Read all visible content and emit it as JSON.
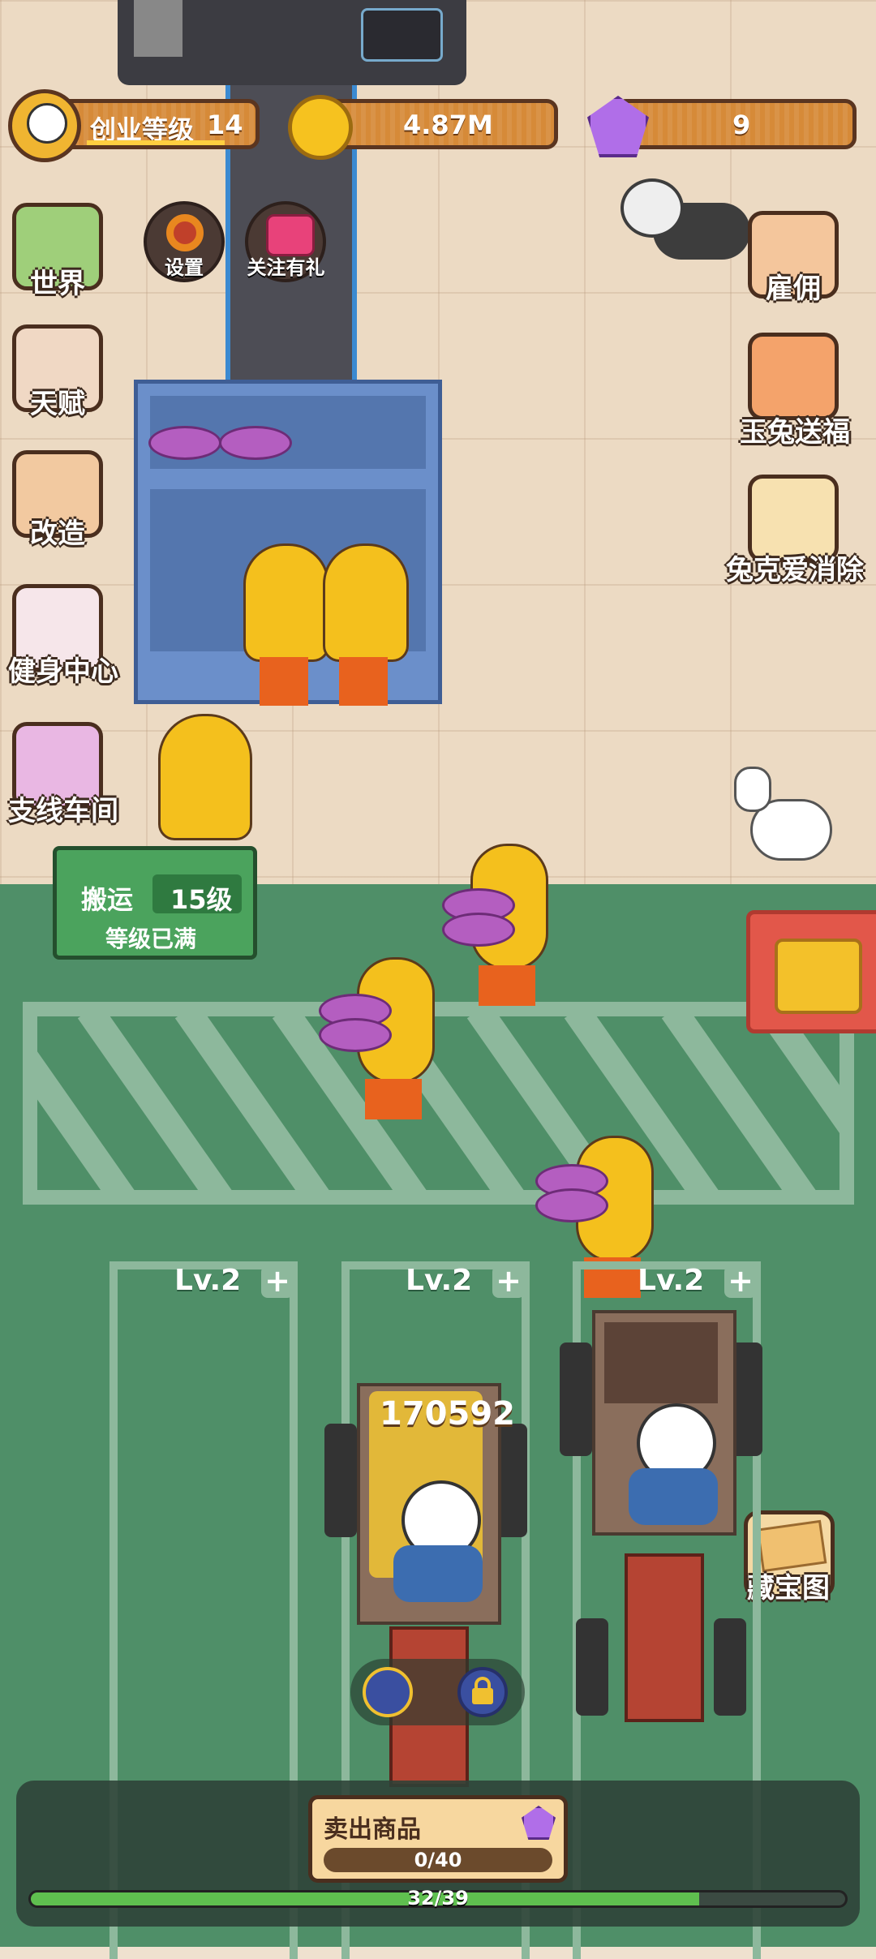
{
  "hud": {
    "level_label": "创业等级",
    "level_value": "14",
    "coins": "4.87M",
    "gems": "9"
  },
  "top_buttons": {
    "settings": "设置",
    "follow_gift": "关注有礼"
  },
  "left_menu": [
    {
      "label": "世界"
    },
    {
      "label": "天赋"
    },
    {
      "label": "改造"
    },
    {
      "label": "健身中心"
    },
    {
      "label": "支线车间"
    }
  ],
  "right_menu": [
    {
      "label": "雇佣"
    },
    {
      "label": "玉兔送福"
    },
    {
      "label": "兔克爱消除"
    },
    {
      "label": "藏宝图"
    }
  ],
  "carry_panel": {
    "title": "搬运",
    "level": "15级",
    "status": "等级已满"
  },
  "lanes": [
    {
      "label": "Lv.2"
    },
    {
      "label": "Lv.2"
    },
    {
      "label": "Lv.2"
    }
  ],
  "truck_cargo_value": "170592",
  "sell_panel": {
    "title": "卖出商品",
    "progress_text": "0/40",
    "progress": 0
  },
  "bottom_progress": {
    "text": "32/39",
    "value": 0.8205
  },
  "colors": {
    "floor": "#4f8f68",
    "button_orange": "#d68a38",
    "gem": "#b06ee8",
    "progress_green": "#5fbf4f"
  },
  "icons": [
    "coin-icon",
    "gem-icon",
    "gear-icon",
    "gift-icon",
    "lock-icon",
    "truck-icon",
    "treasure-chest-icon",
    "map-icon"
  ]
}
